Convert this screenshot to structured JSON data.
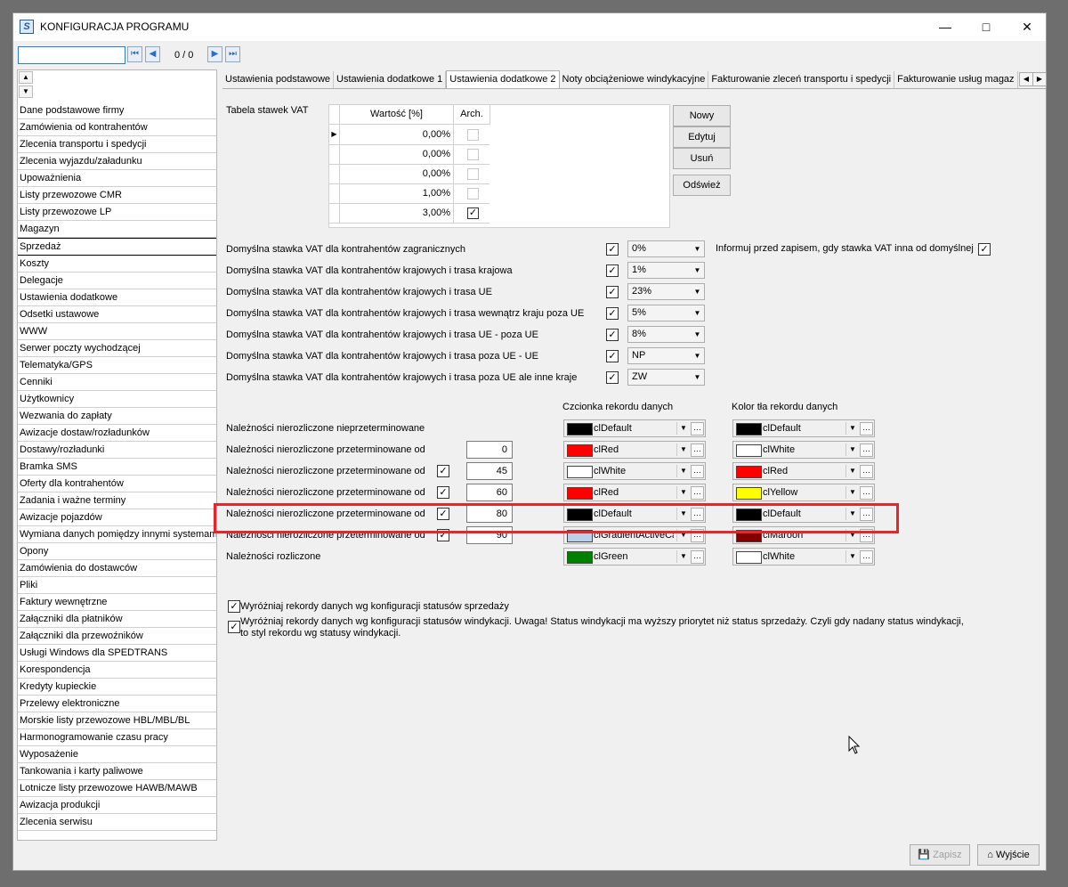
{
  "window": {
    "title": "KONFIGURACJA PROGRAMU",
    "app_icon": "S"
  },
  "toolbar": {
    "counter": "0 / 0",
    "search_value": ""
  },
  "menu": [
    "Dane podstawowe firmy",
    "Zamówienia od kontrahentów",
    "Zlecenia transportu i spedycji",
    "Zlecenia wyjazdu/załadunku",
    "Upoważnienia",
    "Listy przewozowe CMR",
    "Listy przewozowe LP",
    "Magazyn",
    "Sprzedaż",
    "Koszty",
    "Delegacje",
    "Ustawienia dodatkowe",
    "Odsetki ustawowe",
    "WWW",
    "Serwer poczty wychodzącej",
    "Telematyka/GPS",
    "Cenniki",
    "Użytkownicy",
    "Wezwania do zapłaty",
    "Awizacje dostaw/rozładunków",
    "Dostawy/rozładunki",
    "Bramka SMS",
    "Oferty dla kontrahentów",
    "Zadania i ważne terminy",
    "Awizacje pojazdów",
    "Wymiana danych pomiędzy innymi systemami",
    "Opony",
    "Zamówienia do dostawców",
    "Pliki",
    "Faktury wewnętrzne",
    "Załączniki dla płatników",
    "Załączniki dla przewoźników",
    "Usługi Windows dla SPEDTRANS",
    "Korespondencja",
    "Kredyty kupieckie",
    "Przelewy elektroniczne",
    "Morskie listy przewozowe HBL/MBL/BL",
    "Harmonogramowanie czasu pracy",
    "Wyposażenie",
    "Tankowania i karty paliwowe",
    "Lotnicze listy przewozowe HAWB/MAWB",
    "Awizacja produkcji",
    "Zlecenia serwisu"
  ],
  "tabs": [
    "Ustawienia podstawowe",
    "Ustawienia dodatkowe 1",
    "Ustawienia dodatkowe 2",
    "Noty obciążeniowe windykacyjne",
    "Fakturowanie zleceń transportu i spedycji",
    "Fakturowanie usług magaz"
  ],
  "vat": {
    "label": "Tabela stawek VAT",
    "col_value": "Wartość [%]",
    "col_arch": "Arch.",
    "rows": [
      {
        "value": "0,00%",
        "arch": ""
      },
      {
        "value": "0,00%",
        "arch": ""
      },
      {
        "value": "0,00%",
        "arch": ""
      },
      {
        "value": "1,00%",
        "arch": ""
      },
      {
        "value": "3,00%",
        "arch": "✓"
      }
    ],
    "buttons": {
      "new": "Nowy",
      "edit": "Edytuj",
      "delete": "Usuń",
      "refresh": "Odśwież"
    }
  },
  "defaults": [
    {
      "label": "Domyślna stawka VAT dla kontrahentów zagranicznych",
      "value": "0%"
    },
    {
      "label": "Domyślna stawka VAT dla kontrahentów krajowych i trasa krajowa",
      "value": "1%"
    },
    {
      "label": "Domyślna stawka VAT dla kontrahentów krajowych i trasa UE",
      "value": "23%"
    },
    {
      "label": "Domyślna stawka VAT dla kontrahentów krajowych i trasa wewnątrz kraju  poza UE",
      "value": "5%"
    },
    {
      "label": "Domyślna stawka VAT dla kontrahentów krajowych i trasa UE - poza UE",
      "value": "8%"
    },
    {
      "label": "Domyślna stawka VAT dla kontrahentów krajowych i trasa poza UE - UE",
      "value": "NP"
    },
    {
      "label": "Domyślna stawka VAT dla kontrahentów krajowych i trasa  poza UE ale inne kraje",
      "value": "ZW"
    }
  ],
  "inform_label": "Informuj przed zapisem, gdy stawka VAT inna od domyślnej",
  "receivables": {
    "font_header": "Czcionka rekordu danych",
    "bg_header": "Kolor tła rekordu danych",
    "rows": [
      {
        "label": "Należności nierozliczone nieprzeterminowane",
        "check": false,
        "days": null,
        "font": "clDefault",
        "font_color": "#000000",
        "bg": "clDefault",
        "bg_color": "#000000"
      },
      {
        "label": "Należności nierozliczone przeterminowane od",
        "check": false,
        "days": "0",
        "font": "clRed",
        "font_color": "#ff0000",
        "bg": "clWhite",
        "bg_color": "#ffffff"
      },
      {
        "label": "Należności nierozliczone przeterminowane od",
        "check": true,
        "days": "45",
        "font": "clWhite",
        "font_color": "#ffffff",
        "bg": "clRed",
        "bg_color": "#ff0000"
      },
      {
        "label": "Należności nierozliczone przeterminowane od",
        "check": true,
        "days": "60",
        "font": "clRed",
        "font_color": "#ff0000",
        "bg": "clYellow",
        "bg_color": "#ffff00"
      },
      {
        "label": "Należności nierozliczone przeterminowane od",
        "check": true,
        "days": "80",
        "font": "clDefault",
        "font_color": "#000000",
        "bg": "clDefault",
        "bg_color": "#000000"
      },
      {
        "label": "Należności nierozliczone przeterminowane od",
        "check": true,
        "days": "90",
        "font": "clGradientActiveCa",
        "font_color": "#b9d1ea",
        "bg": "clMaroon",
        "bg_color": "#800000"
      },
      {
        "label": "Należności rozliczone",
        "check": false,
        "days": null,
        "font": "clGreen",
        "font_color": "#008000",
        "bg": "clWhite",
        "bg_color": "#ffffff"
      }
    ]
  },
  "options": {
    "opt1": "Wyróżniaj rekordy danych wg konfiguracji statusów sprzedaży",
    "opt2_line1": "Wyróżniaj rekordy danych wg konfiguracji statusów windykacji. Uwaga! Status windykacji ma wyższy priorytet niż status sprzedaży.  Czyli gdy nadany status windykacji,",
    "opt2_line2": "to styl rekordu wg statusy windykacji."
  },
  "footer": {
    "save": "Zapisz",
    "exit": "Wyjście"
  }
}
